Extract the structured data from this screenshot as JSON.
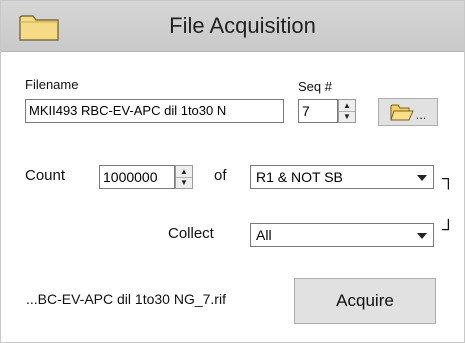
{
  "title": "File Acquisition",
  "filename": {
    "label": "Filename",
    "value": "MKII493 RBC-EV-APC dil 1to30 N"
  },
  "seq": {
    "label": "Seq #",
    "value": "7"
  },
  "browse": {
    "dots": "..."
  },
  "count": {
    "label": "Count",
    "value": "1000000",
    "of_label": "of",
    "gate": "R1 & NOT SB"
  },
  "collect": {
    "label": "Collect",
    "value": "All"
  },
  "output_file": "...BC-EV-APC dil 1to30 NG_7.rif",
  "acquire_label": "Acquire",
  "brackets": {
    "top": "┐",
    "bottom": "┘"
  },
  "colors": {
    "titlebar": "#cfcfcf",
    "folder": "#f3d57a",
    "button": "#e1e1e1"
  },
  "icons": [
    "folder-icon",
    "open-folder-icon",
    "spin-up-icon",
    "spin-down-icon",
    "dropdown-arrow-icon"
  ]
}
